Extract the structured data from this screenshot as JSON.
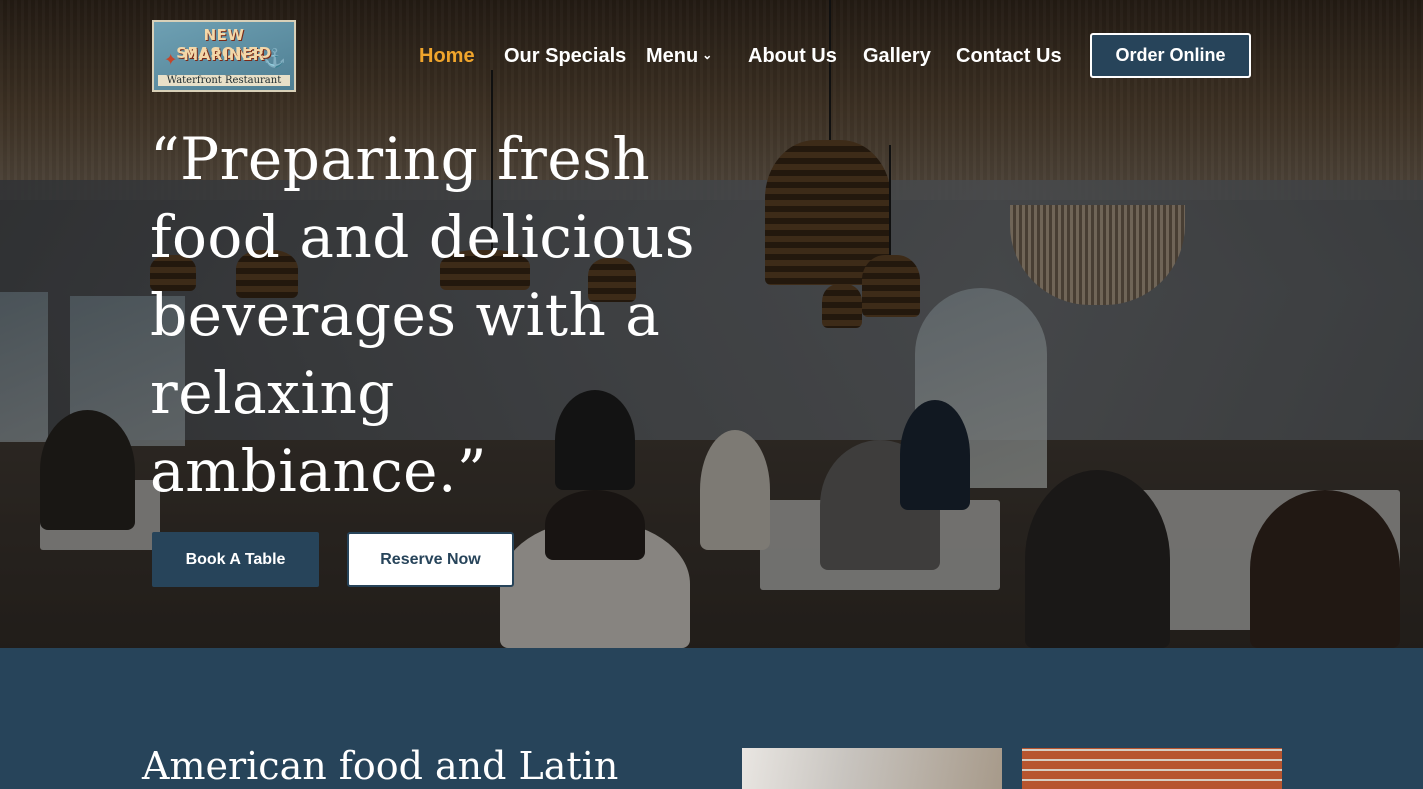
{
  "brand": {
    "logo_line1": "NEW SEASONED",
    "logo_line2": "MARINER",
    "logo_line3": "Waterfront Restaurant"
  },
  "nav": {
    "items": [
      {
        "label": "Home",
        "active": true
      },
      {
        "label": "Our Specials",
        "active": false
      },
      {
        "label": "Menu",
        "active": false,
        "has_dropdown": true
      },
      {
        "label": "About Us",
        "active": false
      },
      {
        "label": "Gallery",
        "active": false
      },
      {
        "label": "Contact Us",
        "active": false
      }
    ],
    "cta": "Order Online"
  },
  "hero": {
    "headline": "“Preparing fresh food and delicious beverages with a relaxing ambiance.”",
    "primary_button": "Book A Table",
    "secondary_button": "Reserve Now"
  },
  "section": {
    "heading": "American food and Latin"
  },
  "colors": {
    "accent": "#f0a52c",
    "navy": "#27445a",
    "white": "#ffffff"
  }
}
